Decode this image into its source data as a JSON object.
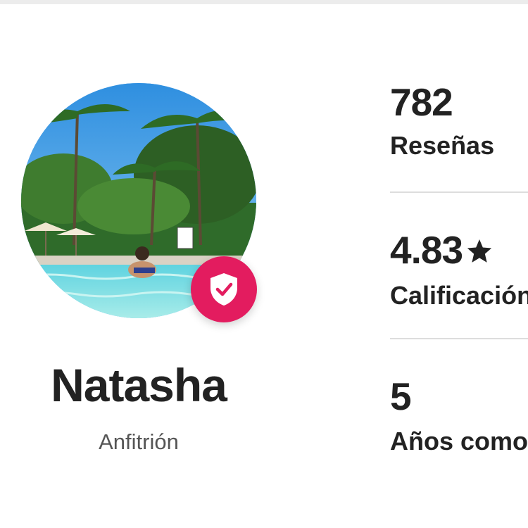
{
  "profile": {
    "name": "Natasha",
    "role": "Anfitrión",
    "verified_badge_icon": "shield-check-icon",
    "avatar_description_icon": "profile-photo"
  },
  "stats": {
    "reviews_value": "782",
    "reviews_label": "Reseñas",
    "rating_value": "4.83",
    "rating_icon": "star-icon",
    "rating_label": "Calificación",
    "years_value": "5",
    "years_label": "Años como anfitrión"
  },
  "colors": {
    "accent": "#e31c5f",
    "text": "#222222",
    "muted": "#555555",
    "divider": "#dddddd"
  }
}
